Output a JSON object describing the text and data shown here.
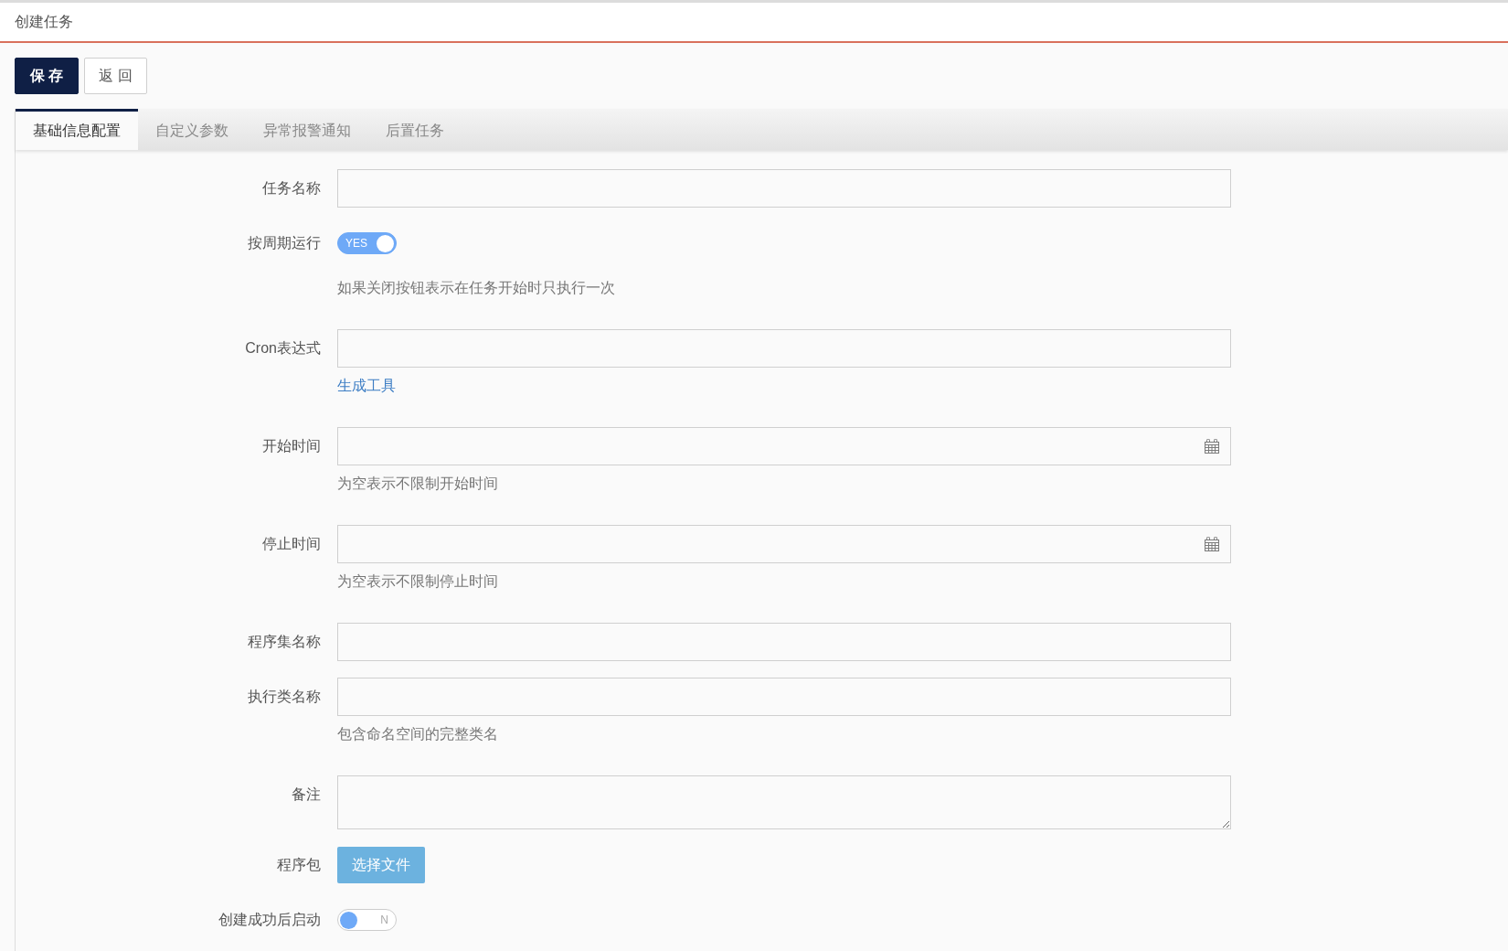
{
  "header": {
    "title": "创建任务"
  },
  "toolbar": {
    "buttons": [
      {
        "label": "保 存",
        "kind": "primary"
      },
      {
        "label": "返 回",
        "kind": "secondary"
      }
    ]
  },
  "tabs": [
    {
      "label": "基础信息配置",
      "selected": true
    },
    {
      "label": "自定义参数",
      "selected": false
    },
    {
      "label": "异常报警通知",
      "selected": false
    },
    {
      "label": "后置任务",
      "selected": false
    }
  ],
  "form": {
    "fields": [
      {
        "kind": "text",
        "label": "任务名称"
      },
      {
        "kind": "switch",
        "label": "按周期运行",
        "on": true,
        "switch_text": "YES",
        "hint": "如果关闭按钮表示在任务开始时只执行一次"
      },
      {
        "kind": "text",
        "label": "Cron表达式",
        "link": "生成工具"
      },
      {
        "kind": "date",
        "label": "开始时间",
        "hint": "为空表示不限制开始时间"
      },
      {
        "kind": "date",
        "label": "停止时间",
        "hint": "为空表示不限制停止时间"
      },
      {
        "kind": "text",
        "label": "程序集名称"
      },
      {
        "kind": "text",
        "label": "执行类名称",
        "hint": "包含命名空间的完整类名"
      },
      {
        "kind": "textarea",
        "label": "备注"
      },
      {
        "kind": "file",
        "label": "程序包",
        "button": "选择文件"
      },
      {
        "kind": "switch",
        "label": "创建成功后启动",
        "on": false,
        "switch_text": "N"
      }
    ]
  }
}
